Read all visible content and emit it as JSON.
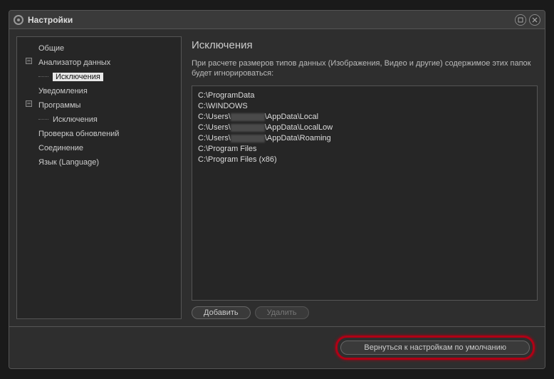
{
  "window": {
    "title": "Настройки"
  },
  "sidebar": {
    "items": [
      {
        "label": "Общие",
        "level": 1,
        "expander": null
      },
      {
        "label": "Анализатор данных",
        "level": 1,
        "expander": "−"
      },
      {
        "label": "Исключения",
        "level": 2,
        "expander": null,
        "selected": true
      },
      {
        "label": "Уведомления",
        "level": 1,
        "expander": null
      },
      {
        "label": "Программы",
        "level": 1,
        "expander": "−"
      },
      {
        "label": "Исключения",
        "level": 2,
        "expander": null
      },
      {
        "label": "Проверка обновлений",
        "level": 1,
        "expander": null
      },
      {
        "label": "Соединение",
        "level": 1,
        "expander": null
      },
      {
        "label": "Язык (Language)",
        "level": 1,
        "expander": null
      }
    ]
  },
  "main": {
    "heading": "Исключения",
    "description": "При расчете размеров типов данных (Изображения, Видео и другие) содержимое этих папок будет игнорироваться:",
    "paths": [
      [
        "C:\\ProgramData"
      ],
      [
        "C:\\WINDOWS"
      ],
      [
        "C:\\Users\\",
        "@blur",
        "\\AppData\\Local"
      ],
      [
        "C:\\Users\\",
        "@blur",
        "\\AppData\\LocalLow"
      ],
      [
        "C:\\Users\\",
        "@blur",
        "\\AppData\\Roaming"
      ],
      [
        "C:\\Program Files"
      ],
      [
        "C:\\Program Files (x86)"
      ]
    ],
    "add_label": "Добавить",
    "delete_label": "Удалить"
  },
  "footer": {
    "reset_label": "Вернуться к настройкам по умолчанию"
  }
}
